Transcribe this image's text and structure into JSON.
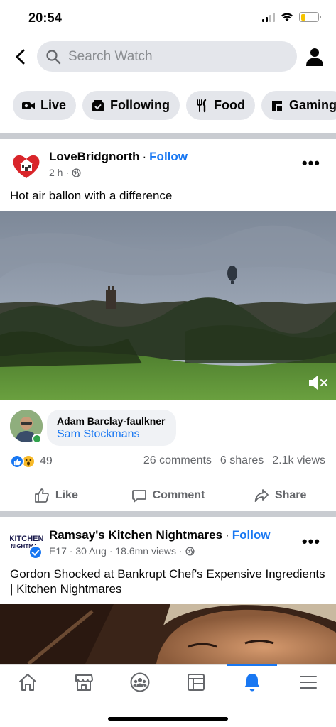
{
  "status_bar": {
    "time": "20:54",
    "battery_level": 0.3
  },
  "search": {
    "placeholder": "Search Watch"
  },
  "chips": [
    {
      "label": "Live",
      "icon": "video-camera-icon"
    },
    {
      "label": "Following",
      "icon": "following-icon"
    },
    {
      "label": "Food",
      "icon": "fork-knife-icon"
    },
    {
      "label": "Gaming",
      "icon": "gaming-icon"
    }
  ],
  "post1": {
    "page_name": "LoveBridgnorth",
    "separator": "·",
    "follow": "Follow",
    "time": "2 h ·",
    "text": "Hot air ballon with a difference",
    "comment": {
      "author": "Adam Barclay-faulkner",
      "text": "Sam Stockmans"
    },
    "reactions": "49",
    "comments": "26 comments",
    "shares": "6 shares",
    "views": "2.1k views"
  },
  "actions": {
    "like": "Like",
    "comment": "Comment",
    "share": "Share"
  },
  "post2": {
    "page_name": "Ramsay's Kitchen Nightmares",
    "separator": "·",
    "follow": "Follow",
    "meta": "E17 · 30 Aug · 18.6mn views ·",
    "text": "Gordon Shocked at Bankrupt Chef's Expensive Ingredients | Kitchen Nightmares"
  },
  "tabs": [
    "home-icon",
    "marketplace-icon",
    "groups-icon",
    "feeds-icon",
    "notifications-icon",
    "menu-icon"
  ],
  "active_tab": "notifications-icon",
  "colors": {
    "brand_blue": "#1877f2",
    "chip_bg": "#e4e6eb",
    "divider": "#c9ccd1"
  }
}
